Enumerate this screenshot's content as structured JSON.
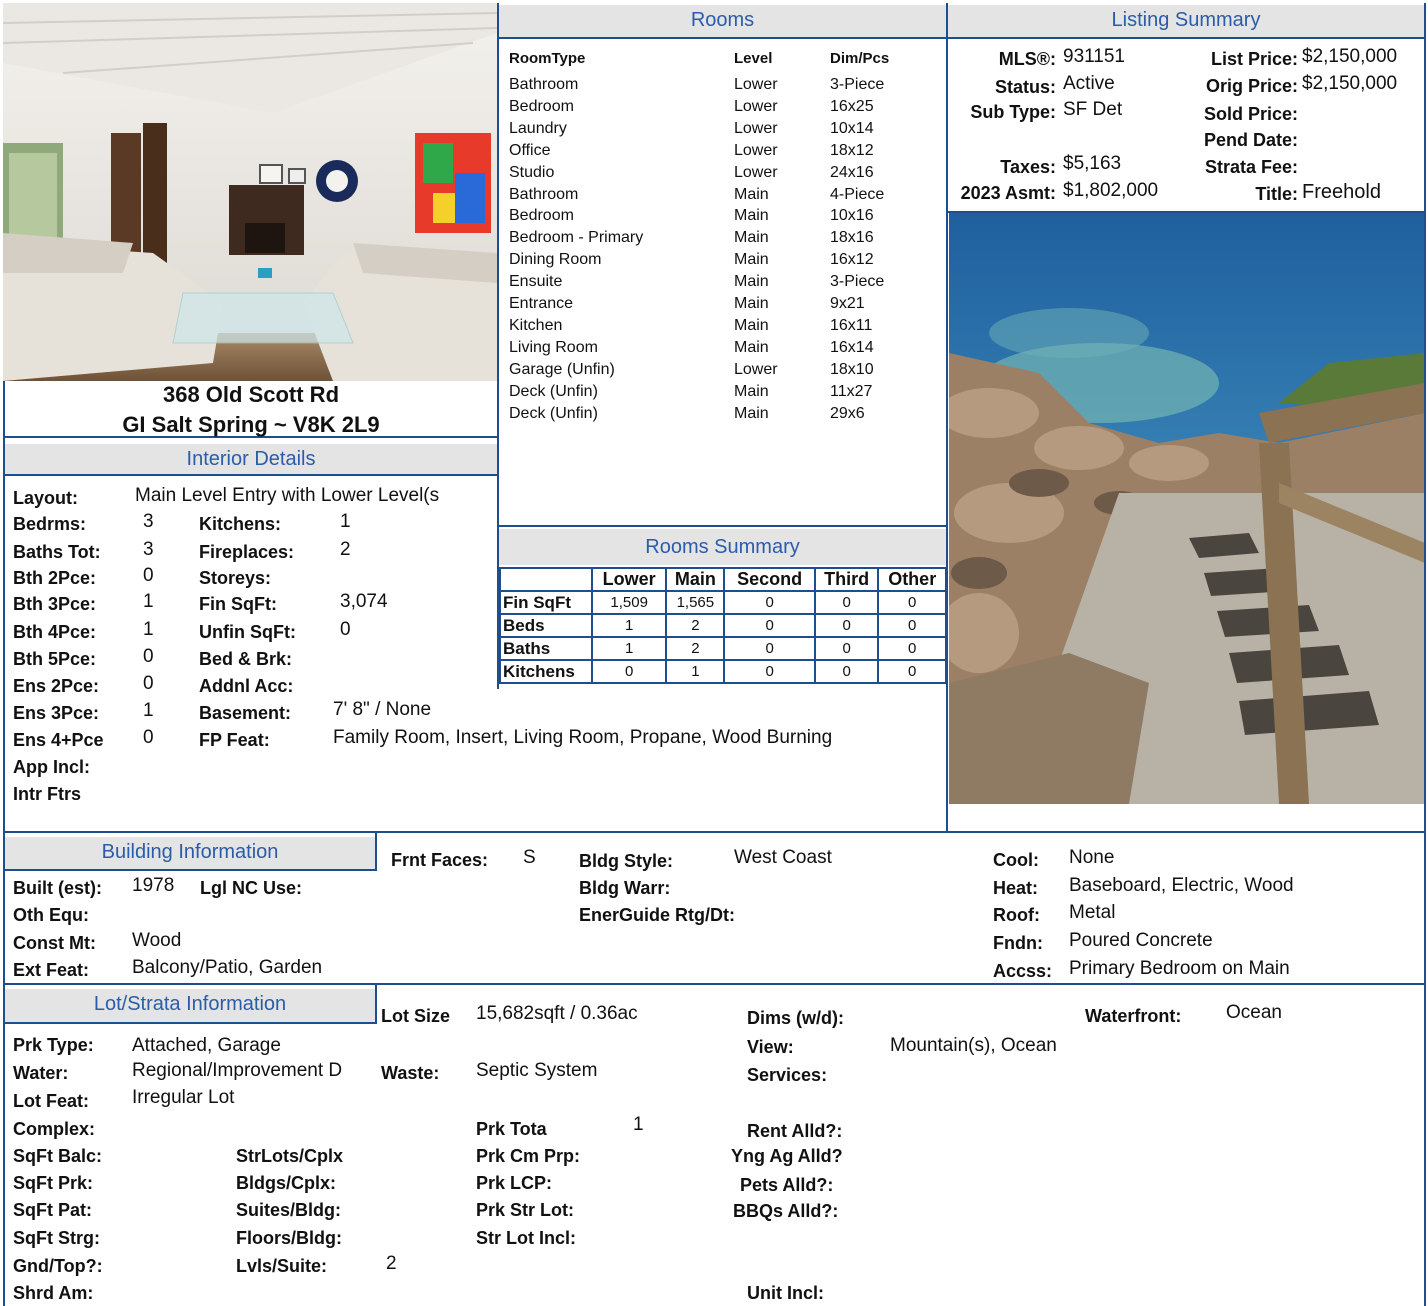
{
  "property": {
    "address_line1": "368 Old Scott Rd",
    "address_line2": "GI Salt Spring  ~  V8K 2L9"
  },
  "headers": {
    "rooms": "Rooms",
    "listing_summary": "Listing Summary",
    "interior_details": "Interior Details",
    "rooms_summary": "Rooms Summary",
    "building_info": "Building Information",
    "lot_strata": "Lot/Strata Information"
  },
  "rooms": {
    "col_type": "RoomType",
    "col_level": "Level",
    "col_dim": "Dim/Pcs",
    "items": [
      {
        "type": "Bathroom",
        "level": "Lower",
        "dim": "3-Piece"
      },
      {
        "type": "Bedroom",
        "level": "Lower",
        "dim": "16x25"
      },
      {
        "type": "Laundry",
        "level": "Lower",
        "dim": "10x14"
      },
      {
        "type": "Office",
        "level": "Lower",
        "dim": "18x12"
      },
      {
        "type": "Studio",
        "level": "Lower",
        "dim": "24x16"
      },
      {
        "type": "Bathroom",
        "level": "Main",
        "dim": "4-Piece"
      },
      {
        "type": "Bedroom",
        "level": "Main",
        "dim": "10x16"
      },
      {
        "type": "Bedroom - Primary",
        "level": "Main",
        "dim": "18x16"
      },
      {
        "type": "Dining Room",
        "level": "Main",
        "dim": "16x12"
      },
      {
        "type": "Ensuite",
        "level": "Main",
        "dim": "3-Piece"
      },
      {
        "type": "Entrance",
        "level": "Main",
        "dim": "9x21"
      },
      {
        "type": "Kitchen",
        "level": "Main",
        "dim": "16x11"
      },
      {
        "type": "Living Room",
        "level": "Main",
        "dim": "16x14"
      },
      {
        "type": "Garage (Unfin)",
        "level": "Lower",
        "dim": "18x10"
      },
      {
        "type": "Deck (Unfin)",
        "level": "Main",
        "dim": "11x27"
      },
      {
        "type": "Deck (Unfin)",
        "level": "Main",
        "dim": "29x6"
      }
    ]
  },
  "rooms_summary": {
    "columns": [
      "Lower",
      "Main",
      "Second",
      "Third",
      "Other"
    ],
    "rows": [
      {
        "label": "Fin SqFt",
        "values": [
          "1,509",
          "1,565",
          "0",
          "0",
          "0"
        ]
      },
      {
        "label": "Beds",
        "values": [
          "1",
          "2",
          "0",
          "0",
          "0"
        ]
      },
      {
        "label": "Baths",
        "values": [
          "1",
          "2",
          "0",
          "0",
          "0"
        ]
      },
      {
        "label": "Kitchens",
        "values": [
          "0",
          "1",
          "0",
          "0",
          "0"
        ]
      }
    ]
  },
  "listing": {
    "mls_label": "MLS®:",
    "mls": "931151",
    "status_label": "Status:",
    "status": "Active",
    "subtype_label": "Sub Type:",
    "subtype": "SF Det",
    "taxes_label": "Taxes:",
    "taxes": "$5,163",
    "asmt_label": "2023 Asmt:",
    "asmt": "$1,802,000",
    "list_price_label": "List Price:",
    "list_price": "$2,150,000",
    "orig_price_label": "Orig Price:",
    "orig_price": "$2,150,000",
    "sold_price_label": "Sold Price:",
    "pend_date_label": "Pend Date:",
    "strata_fee_label": "Strata Fee:",
    "title_label": "Title:",
    "title": "Freehold"
  },
  "interior": {
    "layout_label": "Layout:",
    "layout": "Main Level Entry with Lower Level(s",
    "bedrms_label": "Bedrms:",
    "bedrms": "3",
    "baths_tot_label": "Baths Tot:",
    "baths_tot": "3",
    "bth2_label": "Bth 2Pce:",
    "bth2": "0",
    "bth3_label": "Bth 3Pce:",
    "bth3": "1",
    "bth4_label": "Bth 4Pce:",
    "bth4": "1",
    "bth5_label": "Bth 5Pce:",
    "bth5": "0",
    "ens2_label": "Ens 2Pce:",
    "ens2": "0",
    "ens3_label": "Ens 3Pce:",
    "ens3": "1",
    "ens4_label": "Ens 4+Pce",
    "ens4": "0",
    "app_incl_label": "App Incl:",
    "intr_ftrs_label": "Intr Ftrs",
    "kitchens_label": "Kitchens:",
    "kitchens": "1",
    "fireplaces_label": "Fireplaces:",
    "fireplaces": "2",
    "storeys_label": "Storeys:",
    "fin_sqft_label": "Fin SqFt:",
    "fin_sqft": "3,074",
    "unfin_sqft_label": "Unfin SqFt:",
    "unfin_sqft": "0",
    "bed_brk_label": "Bed & Brk:",
    "addnl_acc_label": "Addnl Acc:",
    "basement_label": "Basement:",
    "basement": "7' 8\" / None",
    "fp_feat_label": "FP Feat:",
    "fp_feat": "Family Room, Insert, Living Room, Propane, Wood Burning"
  },
  "building": {
    "frnt_faces_label": "Frnt Faces:",
    "frnt_faces": "S",
    "built_label": "Built (est):",
    "built": "1978",
    "lgl_nc_label": "Lgl NC Use:",
    "oth_equ_label": "Oth Equ:",
    "const_mt_label": "Const Mt:",
    "const_mt": "Wood",
    "ext_feat_label": "Ext Feat:",
    "ext_feat": "Balcony/Patio, Garden",
    "bldg_style_label": "Bldg Style:",
    "bldg_style": "West Coast",
    "bldg_warr_label": "Bldg Warr:",
    "energuide_label": "EnerGuide Rtg/Dt:",
    "cool_label": "Cool:",
    "cool": "None",
    "heat_label": "Heat:",
    "heat": "Baseboard, Electric, Wood",
    "roof_label": "Roof:",
    "roof": "Metal",
    "fndn_label": "Fndn:",
    "fndn": "Poured Concrete",
    "accss_label": "Accss:",
    "accss": "Primary Bedroom on Main"
  },
  "lot": {
    "lot_size_label": "Lot Size",
    "lot_size": "15,682sqft / 0.36ac",
    "dims_label": "Dims (w/d):",
    "waterfront_label": "Waterfront:",
    "waterfront": "Ocean",
    "prk_type_label": "Prk Type:",
    "prk_type": "Attached, Garage",
    "water_label": "Water:",
    "water": "Regional/Improvement D",
    "waste_label": "Waste:",
    "waste": "Septic System",
    "lot_feat_label": "Lot Feat:",
    "lot_feat": "Irregular Lot",
    "view_label": "View:",
    "view": "Mountain(s), Ocean",
    "services_label": "Services:",
    "complex_label": "Complex:",
    "prk_tota_label": "Prk Tota",
    "prk_tota": "1",
    "rent_alld_label": "Rent Alld?:",
    "sqft_balc_label": "SqFt Balc:",
    "strlots_label": "StrLots/Cplx",
    "prk_cm_prp_label": "Prk Cm Prp:",
    "yng_ag_label": "Yng Ag Alld?",
    "sqft_prk_label": "SqFt Prk:",
    "bldgs_cplx_label": "Bldgs/Cplx:",
    "prk_lcp_label": "Prk LCP:",
    "pets_alld_label": "Pets Alld?:",
    "sqft_pat_label": "SqFt Pat:",
    "suites_bldg_label": "Suites/Bldg:",
    "prk_str_lot_label": "Prk Str Lot:",
    "bbqs_alld_label": "BBQs Alld?:",
    "sqft_strg_label": "SqFt Strg:",
    "floors_bldg_label": "Floors/Bldg:",
    "str_lot_incl_label": "Str Lot Incl:",
    "gnd_top_label": "Gnd/Top?:",
    "lvls_suite_label": "Lvls/Suite:",
    "lvls_suite": "2",
    "shrd_am_label": "Shrd Am:",
    "unit_incl_label": "Unit Incl:"
  }
}
